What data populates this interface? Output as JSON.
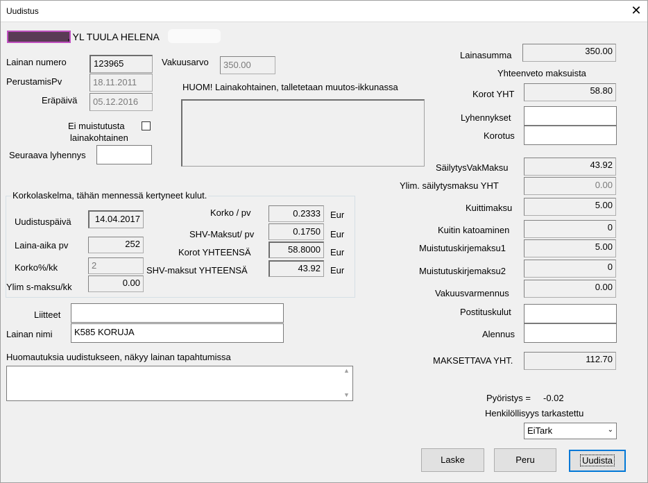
{
  "window": {
    "title": "Uudistus"
  },
  "customer": {
    "name": ", YL TUULA HELENA"
  },
  "loan": {
    "number_label": "Lainan numero",
    "number_value": "123965",
    "collateral_label": "Vakuusarvo",
    "collateral_value": "350.00",
    "founded_label": "PerustamisPv",
    "founded_value": "18.11.2011",
    "due_label": "Eräpäivä",
    "due_value": "05.12.2016",
    "note_label": "HUOM! Lainakohtainen, talletetaan muutos-ikkunassa",
    "note_value": "",
    "no_reminder_label_1": "Ei muistutusta",
    "no_reminder_label_2": "lainakohtainen",
    "next_payment_label": "Seuraava lyhennys",
    "next_payment_value": ""
  },
  "interest": {
    "group_title": "Korkolaskelma, tähän mennessä kertyneet kulut.",
    "renewal_date_label": "Uudistuspäivä",
    "renewal_date_value": "14.04.2017",
    "loan_days_label": "Laina-aika pv",
    "loan_days_value": "252",
    "rate_label": "Korko%/kk",
    "rate_value": "2",
    "extra_fee_label": "Ylim s-maksu/kk",
    "extra_fee_value": "0.00",
    "interest_day_label": "Korko / pv",
    "interest_day_value": "0.2333",
    "shv_day_label": "SHV-Maksut/ pv",
    "shv_day_value": "0.1750",
    "interest_total_label": "Korot YHTEENSÄ",
    "interest_total_value": "58.8000",
    "shv_total_label": "SHV-maksut YHTEENSÄ",
    "shv_total_value": "43.92",
    "unit": "Eur"
  },
  "attachments": {
    "label": "Liitteet",
    "value": ""
  },
  "loan_name": {
    "label": "Lainan nimi",
    "value": "K585 KORUJA"
  },
  "remarks": {
    "label": "Huomautuksia uudistukseen, näkyy lainan tapahtumissa",
    "value": ""
  },
  "summary": {
    "loan_sum_label": "Lainasumma",
    "loan_sum_value": "350.00",
    "heading": "Yhteenveto maksuista",
    "interest_label": "Korot YHT",
    "interest_value": "58.80",
    "repayments_label": "Lyhennykset",
    "repayments_value": "",
    "increase_label": "Korotus",
    "increase_value": "",
    "storage_label": "SäilytysVakMaksu",
    "storage_value": "43.92",
    "extra_storage_label": "Ylim. säilytysmaksu YHT",
    "extra_storage_value": "0.00",
    "receipt_label": "Kuittimaksu",
    "receipt_value": "5.00",
    "receipt_lost_label": "Kuitin katoaminen",
    "receipt_lost_value": "0",
    "reminder1_label": "Muistutuskirjemaksu1",
    "reminder1_value": "5.00",
    "reminder2_label": "Muistutuskirjemaksu2",
    "reminder2_value": "0",
    "verification_label": "Vakuusvarmennus",
    "verification_value": "0.00",
    "postage_label": "Postituskulut",
    "postage_value": "",
    "discount_label": "Alennus",
    "discount_value": "",
    "payable_label": "MAKSETTAVA YHT.",
    "payable_value": "112.70",
    "rounding_label": "Pyöristys =",
    "rounding_value": "-0.02",
    "identity_label": "Henkilöllisyys tarkastettu",
    "identity_value": "EiTark"
  },
  "buttons": {
    "calculate": "Laske",
    "cancel": "Peru",
    "renew": "Uudista"
  }
}
